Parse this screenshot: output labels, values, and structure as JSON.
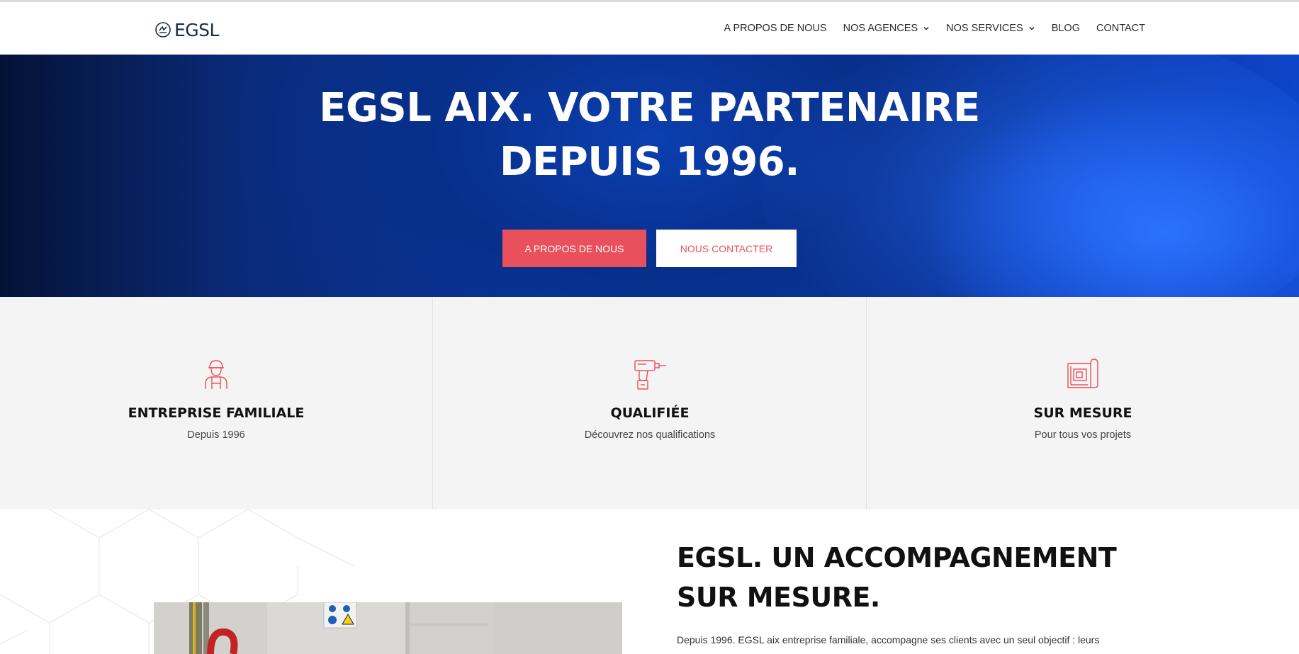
{
  "header": {
    "logo_text": "EGSL",
    "nav": [
      {
        "label": "A PROPOS DE NOUS",
        "dropdown": false
      },
      {
        "label": "NOS AGENCES",
        "dropdown": true
      },
      {
        "label": "NOS SERVICES",
        "dropdown": true
      },
      {
        "label": "BLOG",
        "dropdown": false
      },
      {
        "label": "CONTACT",
        "dropdown": false
      }
    ]
  },
  "hero": {
    "title_line1": "EGSL AIX. VOTRE PARTENAIRE",
    "title_line2": "DEPUIS 1996.",
    "primary_button": "A PROPOS DE NOUS",
    "secondary_button": "NOUS CONTACTER"
  },
  "features": [
    {
      "icon": "worker-icon",
      "title": "ENTREPRISE FAMILIALE",
      "subtitle": "Depuis 1996"
    },
    {
      "icon": "drill-icon",
      "title": "QUALIFIÉE",
      "subtitle": "Découvrez nos qualifications"
    },
    {
      "icon": "blueprint-icon",
      "title": "SUR MESURE",
      "subtitle": "Pour tous vos projets"
    }
  ],
  "about": {
    "title_line1": "EGSL. UN ACCOMPAGNEMENT",
    "title_line2": "SUR MESURE.",
    "text": "Depuis 1996. EGSL aix entreprise familiale, accompagne ses clients avec un seul objectif : leurs"
  },
  "colors": {
    "accent": "#e8505b",
    "hero_blue": "#0b37a0",
    "text_dark": "#111111",
    "feature_bg": "#f4f4f4"
  }
}
